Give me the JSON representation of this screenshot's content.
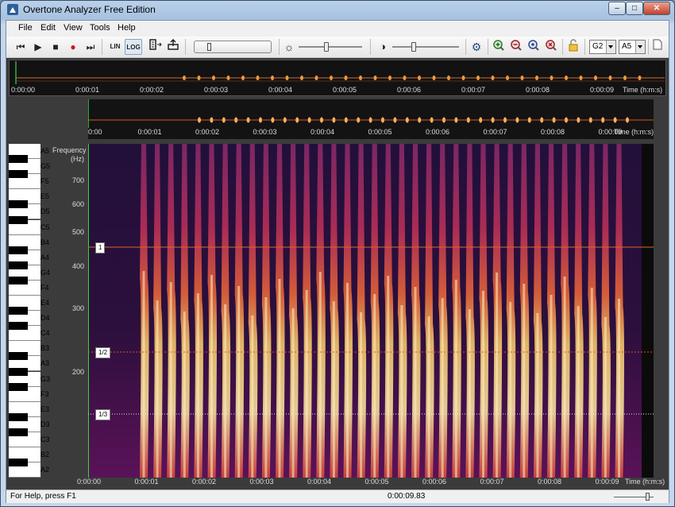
{
  "window": {
    "title": "Overtone Analyzer Free Edition",
    "minimize_glyph": "–",
    "maximize_glyph": "□",
    "close_glyph": "✕"
  },
  "menu": [
    "File",
    "Edit",
    "View",
    "Tools",
    "Help"
  ],
  "toolbar": {
    "lin_label": "LIN",
    "log_label": "LOG",
    "note_select": "G2",
    "note_select_2": "A5",
    "icons": {
      "skip_back": "⏮",
      "play": "▶",
      "stop": "■",
      "record": "●",
      "skip_forward": "⏭",
      "brightness": "☼",
      "contrast": "◑",
      "settings": "⚙",
      "zoom_in": "+",
      "zoom_out": "−",
      "zoom_fit": "○",
      "zoom_reset": "×",
      "lock": "🔓",
      "page": "▯"
    }
  },
  "overview": {
    "time_labels": [
      "0:00:00",
      "0:00:01",
      "0:00:02",
      "0:00:03",
      "0:00:04",
      "0:00:05",
      "0:00:06",
      "0:00:07",
      "0:00:08",
      "0:00:09"
    ],
    "axis_unit": "Time (h:m:s)"
  },
  "waveform": {
    "time_labels": [
      "0:00",
      "0:00:01",
      "0:00:02",
      "0:00:03",
      "0:00:04",
      "0:00:05",
      "0:00:06",
      "0:00:07",
      "0:00:08",
      "0:00:09"
    ],
    "axis_unit": "Time (h:m:s)"
  },
  "spectrogram": {
    "frequency_label_1": "Frequency",
    "frequency_label_2": "(Hz)",
    "freq_ticks": [
      "700",
      "600",
      "500",
      "400",
      "300",
      "200"
    ],
    "harmonic_markers": [
      "1",
      "1/2",
      "1/3"
    ],
    "time_labels": [
      "0:00:00",
      "0:00:01",
      "0:00:02",
      "0:00:03",
      "0:00:04",
      "0:00:05",
      "0:00:06",
      "0:00:07",
      "0:00:08",
      "0:00:09"
    ],
    "axis_unit": "Time (h:m:s)"
  },
  "piano": {
    "notes": [
      "A5",
      "G5",
      "F5",
      "E5",
      "D5",
      "C5",
      "B4",
      "A4",
      "G4",
      "F4",
      "E4",
      "D4",
      "C4",
      "B3",
      "A3",
      "G3",
      "F3",
      "E3",
      "D3",
      "C3",
      "B2",
      "A2"
    ]
  },
  "status": {
    "help_text": "For Help, press F1",
    "time": "0:00:09.83"
  },
  "colors": {
    "accent_orange": "#e07a2c",
    "marker_line": "#c9431b",
    "background_dark": "#141414"
  }
}
